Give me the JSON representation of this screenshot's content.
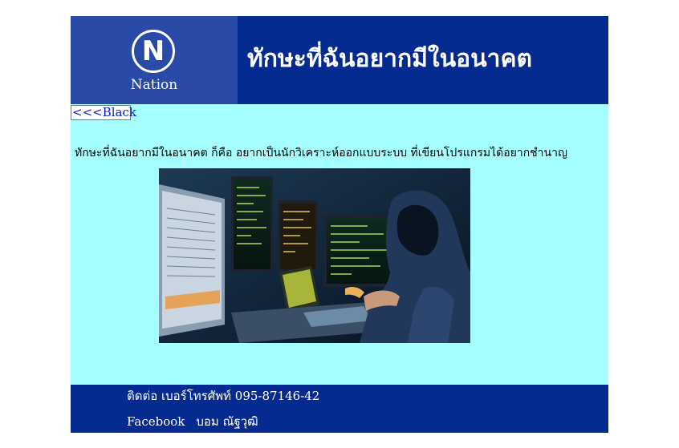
{
  "header": {
    "logo_text": "Nation",
    "logo_letter": "N",
    "title": "ทักษะที่ฉันอยากมีในอนาคต"
  },
  "nav": {
    "back_label": "<<<Black"
  },
  "main": {
    "intro_text": "ทักษะที่ฉันอยากมีในอนาคต ก็คือ อยากเป็นนักวิเคราะห์ออกแบบระบบ ที่เขียนโปรแกรมได้อยากชำนาญ",
    "image_icon": "hacker-at-monitors-photo"
  },
  "footer": {
    "contact_text": "ติดต่อ เบอร์โทรศัพท์ 095-87146-42",
    "facebook_label": "Facebook",
    "facebook_name": "บอม ณัฐวุฒิ"
  },
  "colors": {
    "header_bg": "#062b90",
    "logo_bg": "#2a4aa8",
    "content_bg": "#a6ffff",
    "link": "#0a1ad0"
  }
}
